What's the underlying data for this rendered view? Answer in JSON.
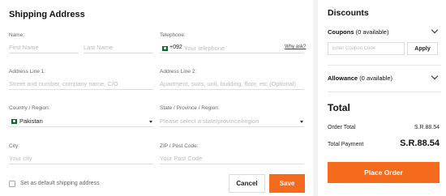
{
  "shipping": {
    "title": "Shipping Address",
    "name_label": "Name:",
    "first_name_placeholder": "First Name",
    "last_name_placeholder": "Last Name",
    "telephone_label": "Telephone:",
    "country_code": "+092",
    "telephone_placeholder": "Your telephone",
    "why_ask": "Why ask?",
    "address1_label": "Address Line 1:",
    "address1_placeholder": "Street and number, company name, C/O",
    "address2_label": "Address Line 2:",
    "address2_placeholder": "Apartment, suits, unit, building, floor, etc (Optional)",
    "country_label": "Country / Region:",
    "country_value": "Pakistan",
    "state_label": "State / Province / Region:",
    "state_placeholder": "Please select a state/province/region",
    "city_label": "City:",
    "city_placeholder": "Your city",
    "zip_label": "ZIP / Post Code:",
    "zip_placeholder": "Your Post Code",
    "default_label": "Set as default shipping address",
    "cancel": "Cancel",
    "save": "Save"
  },
  "summary": {
    "discounts_title": "Discounts",
    "coupons_label": "Coupons",
    "coupons_count": "(0 available)",
    "coupon_placeholder": "Enter Coupon Code",
    "apply": "Apply",
    "allowance_label": "Allowance",
    "allowance_count": "(0 available)",
    "total_title": "Total",
    "order_total_label": "Order Total",
    "order_total_value": "S.R.88.54",
    "total_payment_label": "Total Payment",
    "total_payment_value": "S.R.88.54",
    "place_order": "Place Order"
  },
  "colors": {
    "accent": "#f46b1e",
    "flag_green": "#0a6b2c"
  },
  "icons": {
    "country_flag": "pakistan-flag-icon",
    "dropdown": "caret-down-icon",
    "expand": "chevron-down-icon"
  }
}
